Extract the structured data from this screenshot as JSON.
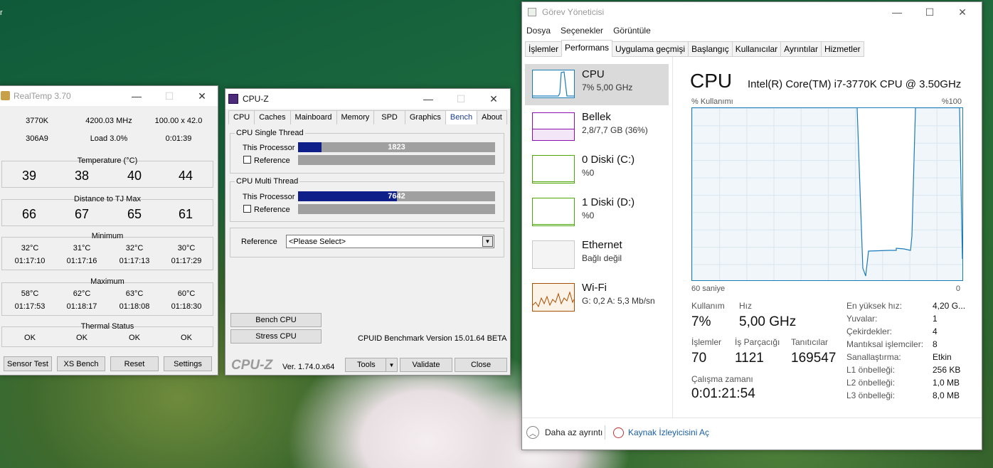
{
  "desktop_glyph": "r",
  "realtemp": {
    "title": "RealTemp 3.70",
    "info": {
      "cpu": "3770K",
      "mhz": "4200.03 MHz",
      "mult": "100.00 x 42.0",
      "cpuid": "306A9",
      "load": "Load  3.0%",
      "time": "0:01:39"
    },
    "temperature_label": "Temperature (°C)",
    "temps": [
      "39",
      "38",
      "40",
      "44"
    ],
    "distance_label": "Distance to TJ Max",
    "distance": [
      "66",
      "67",
      "65",
      "61"
    ],
    "minimum_label": "Minimum",
    "min_temps": [
      "32°C",
      "31°C",
      "32°C",
      "30°C"
    ],
    "min_times": [
      "01:17:10",
      "01:17:16",
      "01:17:13",
      "01:17:29"
    ],
    "maximum_label": "Maximum",
    "max_temps": [
      "58°C",
      "62°C",
      "63°C",
      "60°C"
    ],
    "max_times": [
      "01:17:53",
      "01:18:17",
      "01:18:08",
      "01:18:30"
    ],
    "thermal_label": "Thermal Status",
    "thermal": [
      "OK",
      "OK",
      "OK",
      "OK"
    ],
    "buttons": [
      "Sensor Test",
      "XS Bench",
      "Reset",
      "Settings"
    ]
  },
  "cpuz": {
    "title": "CPU-Z",
    "tabs": [
      "CPU",
      "Caches",
      "Mainboard",
      "Memory",
      "SPD",
      "Graphics",
      "Bench",
      "About"
    ],
    "active_tab": "Bench",
    "single_label": "CPU Single Thread",
    "multi_label": "CPU Multi Thread",
    "this_processor": "This Processor",
    "reference": "Reference",
    "single_score": "1823",
    "single_fraction": 0.12,
    "multi_score": "7642",
    "multi_fraction": 0.5,
    "reference_row_label": "Reference",
    "reference_select": "<Please Select>",
    "bench_btn": "Bench CPU",
    "stress_btn": "Stress CPU",
    "bench_version": "CPUID Benchmark Version 15.01.64 BETA",
    "logo": "CPU-Z",
    "version": "Ver. 1.74.0.x64",
    "tools": "Tools",
    "validate": "Validate",
    "close": "Close"
  },
  "taskmgr": {
    "title": "Görev Yöneticisi",
    "menu": [
      "Dosya",
      "Seçenekler",
      "Görüntüle"
    ],
    "tabs": [
      "İşlemler",
      "Performans",
      "Uygulama geçmişi",
      "Başlangıç",
      "Kullanıcılar",
      "Ayrıntılar",
      "Hizmetler"
    ],
    "active_tab": "Performans",
    "side": [
      {
        "name": "CPU",
        "sub": "7% 5,00 GHz",
        "color": "#1a7bb9"
      },
      {
        "name": "Bellek",
        "sub": "2,8/7,7 GB (36%)",
        "color": "#8b12ae"
      },
      {
        "name": "0 Diski (C:)",
        "sub": "%0",
        "color": "#4da60c"
      },
      {
        "name": "1 Diski (D:)",
        "sub": "%0",
        "color": "#4da60c"
      },
      {
        "name": "Ethernet",
        "sub": "Bağlı değil",
        "color": "#c8c8c8"
      },
      {
        "name": "Wi-Fi",
        "sub": "G: 0,2  A: 5,3 Mb/sn",
        "color": "#a74f01"
      }
    ],
    "cpu_heading": "CPU",
    "cpu_model": "Intel(R) Core(TM) i7-3770K CPU @ 3.50GHz",
    "usage_label": "% Kullanımı",
    "usage_max": "%100",
    "time_span": "60 saniye",
    "time_zero": "0",
    "utilization_label": "Kullanım",
    "utilization": "7%",
    "speed_label": "Hız",
    "speed": "5,00 GHz",
    "processes_label": "İşlemler",
    "processes": "70",
    "threads_label": "İş Parçacığı",
    "threads": "1121",
    "handles_label": "Tanıtıcılar",
    "handles": "169547",
    "uptime_label": "Çalışma zamanı",
    "uptime": "0:01:21:54",
    "specs": [
      {
        "k": "En yüksek hız:",
        "v": "4,20 G..."
      },
      {
        "k": "Yuvalar:",
        "v": "1"
      },
      {
        "k": "Çekirdekler:",
        "v": "4"
      },
      {
        "k": "Mantıksal işlemciler:",
        "v": "8"
      },
      {
        "k": "Sanallaştırma:",
        "v": "Etkin"
      },
      {
        "k": "L1 önbelleği:",
        "v": "256 KB"
      },
      {
        "k": "L2 önbelleği:",
        "v": "1,0 MB"
      },
      {
        "k": "L3 önbelleği:",
        "v": "8,0 MB"
      }
    ],
    "fewer_details": "Daha az ayrıntı",
    "resource_monitor": "Kaynak İzleyicisini Aç",
    "accent": "#1a7bb9"
  }
}
